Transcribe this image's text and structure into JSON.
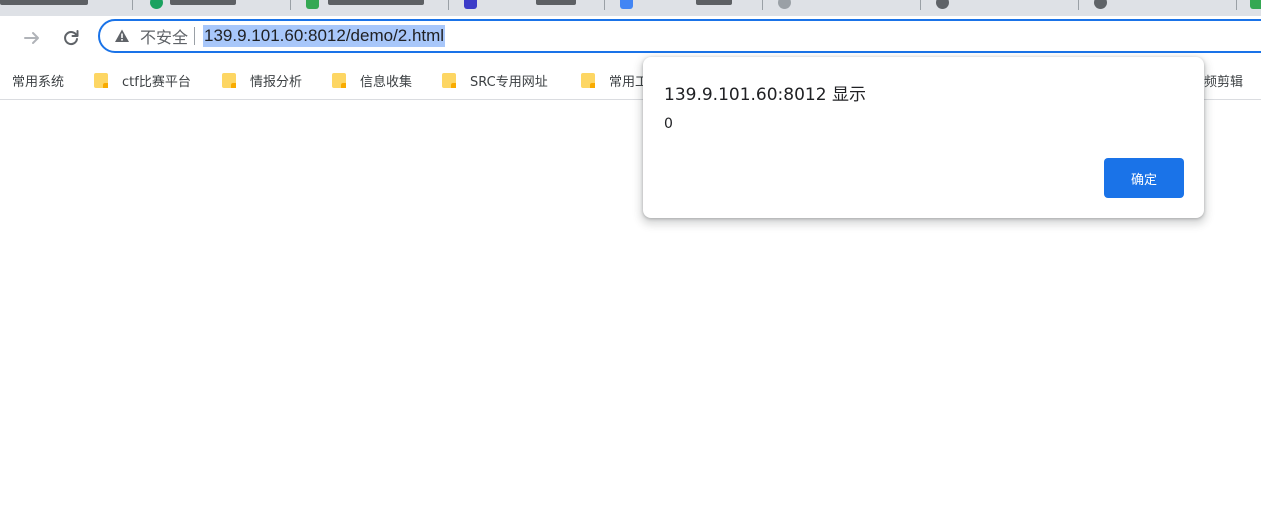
{
  "browser": {
    "accent": "#1a73e8",
    "nav": {
      "forward_icon": "arrow-right-icon",
      "reload_icon": "reload-icon"
    },
    "omnibox": {
      "security_icon": "warning-triangle-icon",
      "security_label": "不安全",
      "url": "139.9.101.60:8012/demo/2.html",
      "selected_color": "#a8c7fa"
    },
    "bookmarks": [
      {
        "label": "常用系统",
        "icon": "none"
      },
      {
        "label": "ctf比赛平台",
        "icon": "folder-icon"
      },
      {
        "label": "情报分析",
        "icon": "folder-icon"
      },
      {
        "label": "信息收集",
        "icon": "folder-icon"
      },
      {
        "label": "SRC专用网址",
        "icon": "folder-icon"
      },
      {
        "label": "常用工",
        "icon": "folder-icon"
      },
      {
        "label": "频剪辑",
        "icon": "none"
      }
    ]
  },
  "alert": {
    "title": "139.9.101.60:8012 显示",
    "message": "0",
    "ok_label": "确定"
  }
}
